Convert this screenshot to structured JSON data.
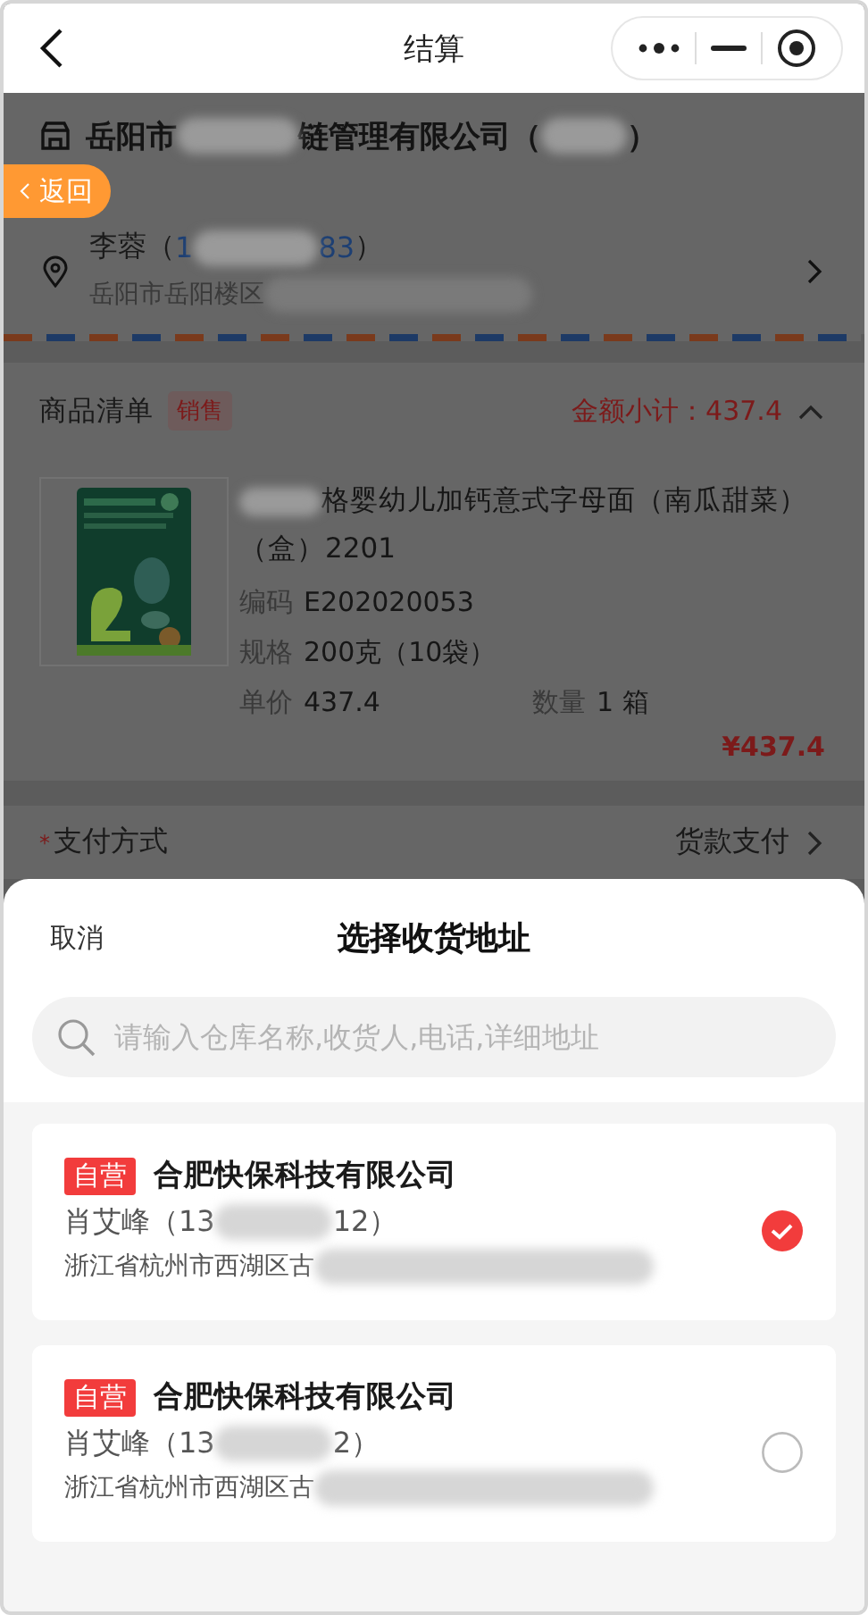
{
  "nav": {
    "title": "结算"
  },
  "store": {
    "name_parts": [
      {
        "kind": "text",
        "text": "岳阳市"
      },
      {
        "kind": "redacted"
      },
      {
        "kind": "text",
        "text": "链管理有限公司"
      },
      {
        "kind": "text",
        "text": "（"
      },
      {
        "kind": "redacted"
      },
      {
        "kind": "text",
        "text": "）"
      }
    ]
  },
  "back_badge": {
    "label": "返回"
  },
  "contact": {
    "person_parts": [
      {
        "kind": "text",
        "text": "李蓉（"
      },
      {
        "kind": "phone",
        "text": "1"
      },
      {
        "kind": "redacted"
      },
      {
        "kind": "phone",
        "text": "83"
      },
      {
        "kind": "text",
        "text": "）"
      }
    ],
    "address_parts": [
      {
        "kind": "text",
        "text": "岳阳市岳阳楼区"
      },
      {
        "kind": "redacted"
      }
    ]
  },
  "goods": {
    "title": "商品清单",
    "tag": "销售",
    "subtotal": "金额小计：437.4",
    "expanded": true,
    "items": [
      {
        "name_parts": [
          {
            "kind": "redacted"
          },
          {
            "kind": "text",
            "text": "格婴幼儿加钙意式字母面（南瓜甜菜）"
          },
          {
            "kind": "text",
            "text": "（盒）2201"
          }
        ],
        "code_label": "编码",
        "code": "E202020053",
        "spec_label": "规格",
        "spec": "200克（10袋）",
        "price_label": "单价",
        "price": "437.4",
        "qty_label": "数量",
        "qty": "1 箱",
        "total": "¥437.4"
      }
    ]
  },
  "payment": {
    "required": "*",
    "label": "支付方式",
    "value": "货款支付"
  },
  "sheet": {
    "cancel": "取消",
    "title": "选择收货地址",
    "search": {
      "placeholder": "请输入仓库名称,收货人,电话,详细地址"
    },
    "addresses": [
      {
        "tag": "自营",
        "company": "合肥快保科技有限公司",
        "person_parts": [
          {
            "kind": "text",
            "text": "肖艾峰（13"
          },
          {
            "kind": "redacted"
          },
          {
            "kind": "text",
            "text": "12）"
          }
        ],
        "address_parts": [
          {
            "kind": "text",
            "text": "浙江省杭州市西湖区古"
          },
          {
            "kind": "redacted"
          }
        ],
        "selected": true
      },
      {
        "tag": "自营",
        "company": "合肥快保科技有限公司",
        "person_parts": [
          {
            "kind": "text",
            "text": "肖艾峰（13"
          },
          {
            "kind": "redacted"
          },
          {
            "kind": "text",
            "text": "2）"
          }
        ],
        "address_parts": [
          {
            "kind": "text",
            "text": "浙江省杭州市西湖区古"
          },
          {
            "kind": "redacted"
          }
        ],
        "selected": false
      }
    ]
  }
}
